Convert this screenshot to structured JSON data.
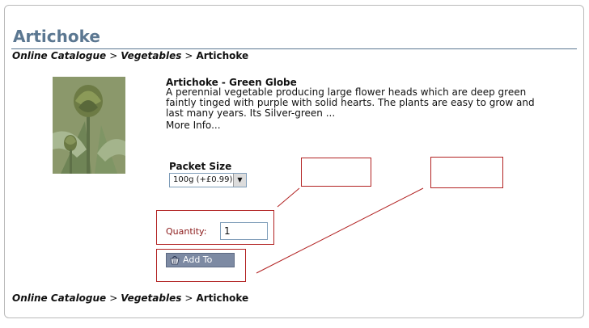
{
  "page": {
    "title": "Artichoke"
  },
  "breadcrumb": {
    "items": [
      "Online Catalogue",
      "Vegetables"
    ],
    "separator": ">",
    "current": "Artichoke"
  },
  "product": {
    "name": "Artichoke - Green Globe",
    "description": "A perennial vegetable producing large flower heads which are deep green faintly tinged with purple with solid hearts. The plants are easy to grow and last many years. Its Silver-green ...",
    "more_info": "More Info...",
    "image_icon": "artichoke-plant-photo"
  },
  "options": {
    "packet_size_label": "Packet Size",
    "packet_size_selected": "100g (+£0.99)"
  },
  "cart": {
    "quantity_label": "Quantity:",
    "quantity_value": "1",
    "add_to_cart_label": "Add To Cart",
    "cart_icon": "basket-icon"
  },
  "colors": {
    "title": "#5b7791",
    "annotation": "#b22222",
    "button": "#7d8aa3",
    "quantity_label": "#8b1a1a"
  }
}
